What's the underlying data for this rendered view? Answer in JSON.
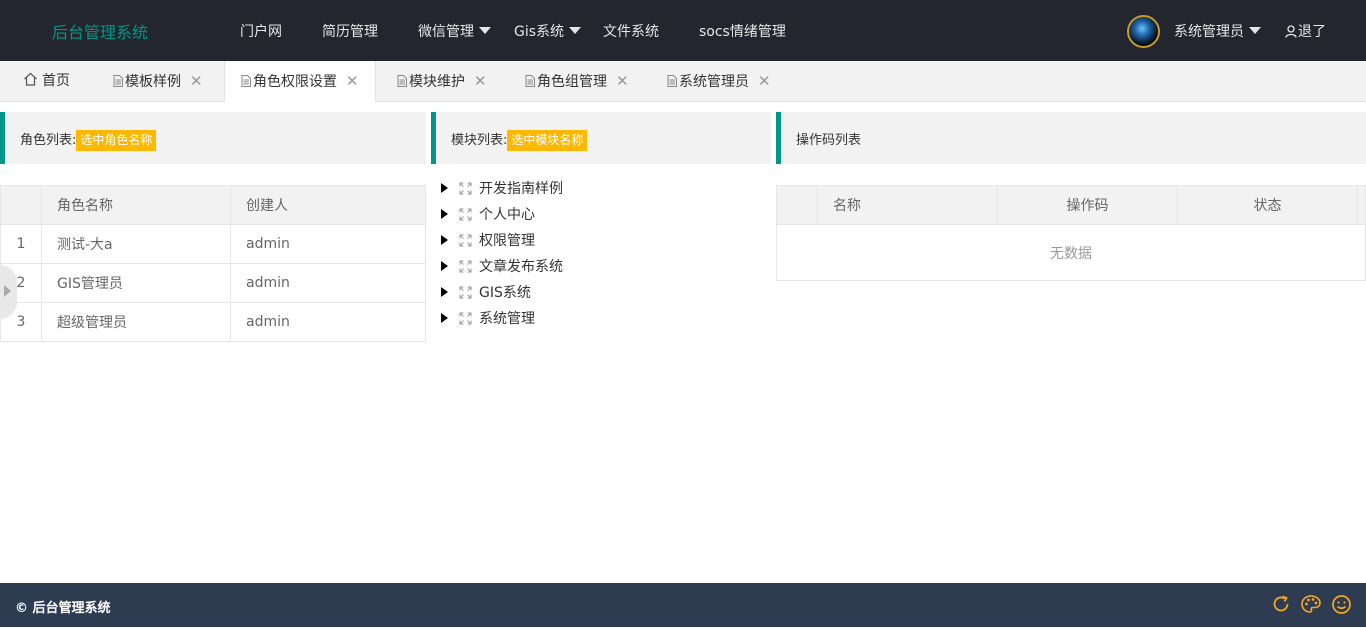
{
  "header": {
    "logo": "后台管理系统",
    "nav": [
      "门户网",
      "简历管理",
      "微信管理",
      "Gis系统",
      "文件系统",
      "socs情绪管理"
    ],
    "user": "系统管理员",
    "logout": "退了"
  },
  "tabs": [
    {
      "label": "首页"
    },
    {
      "label": "模板样例"
    },
    {
      "label": "角色权限设置"
    },
    {
      "label": "模块维护"
    },
    {
      "label": "角色组管理"
    },
    {
      "label": "系统管理员"
    }
  ],
  "roles_panel": {
    "title": "角色列表:",
    "badge": "选中角色名称",
    "columns": [
      "角色名称",
      "创建人"
    ],
    "rows": [
      {
        "num": "1",
        "name": "测试-大a",
        "creator": "admin"
      },
      {
        "num": "2",
        "name": "GIS管理员",
        "creator": "admin"
      },
      {
        "num": "3",
        "name": "超级管理员",
        "creator": "admin"
      }
    ]
  },
  "modules_panel": {
    "title": "模块列表:",
    "badge": "选中模块名称",
    "tree": [
      "开发指南样例",
      "个人中心",
      "权限管理",
      "文章发布系统",
      "GIS系统",
      "系统管理"
    ]
  },
  "opcode_panel": {
    "title": "操作码列表",
    "columns": [
      "名称",
      "操作码",
      "状态"
    ],
    "empty": "无数据"
  },
  "footer": {
    "copyright": "© 后台管理系统"
  },
  "colors": {
    "header_bg": "#23262e",
    "accent": "#009688",
    "badge": "#ffb800",
    "footer_bg": "#2e3c52",
    "footer_icon": "#f5a623"
  }
}
